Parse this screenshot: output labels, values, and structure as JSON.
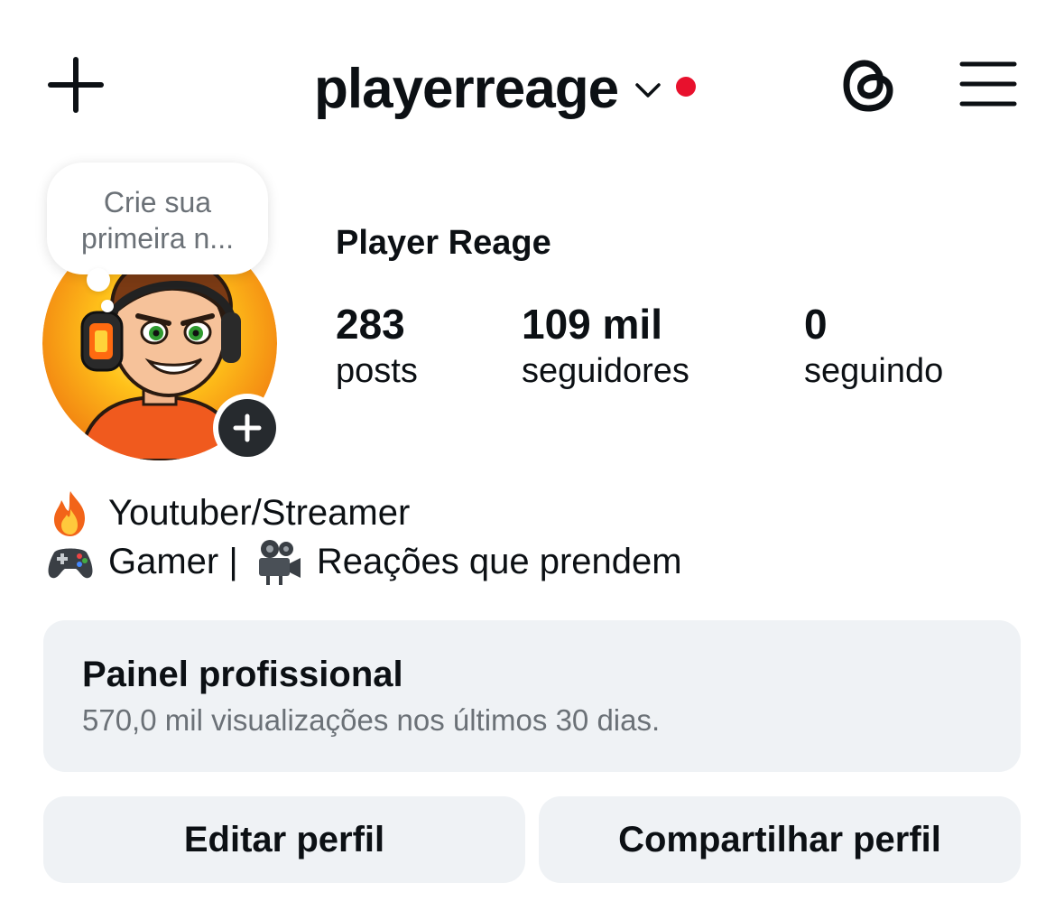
{
  "header": {
    "username": "playerreage",
    "notification_dot_color": "#e8112d",
    "icons": [
      "plus-icon",
      "chevron-down-icon",
      "threads-icon",
      "hamburger-menu-icon"
    ]
  },
  "profile": {
    "note_text": "Crie sua\nprimeira n...",
    "display_name": "Player Reage",
    "stats": [
      {
        "value": "283",
        "label": "posts"
      },
      {
        "value": "109 mil",
        "label": "seguidores"
      },
      {
        "value": "0",
        "label": "seguindo"
      }
    ],
    "bio": [
      {
        "icon": "fire-emoji-icon",
        "text": "Youtuber/Streamer"
      },
      {
        "icon": "game-controller-emoji-icon",
        "text": "Gamer | ",
        "icon2": "movie-camera-emoji-icon",
        "text2": "Reações que prendem"
      }
    ]
  },
  "professional_dashboard": {
    "title": "Painel profissional",
    "subtitle": "570,0 mil visualizações nos últimos 30 dias."
  },
  "buttons": {
    "edit_profile": "Editar perfil",
    "share_profile": "Compartilhar perfil"
  }
}
